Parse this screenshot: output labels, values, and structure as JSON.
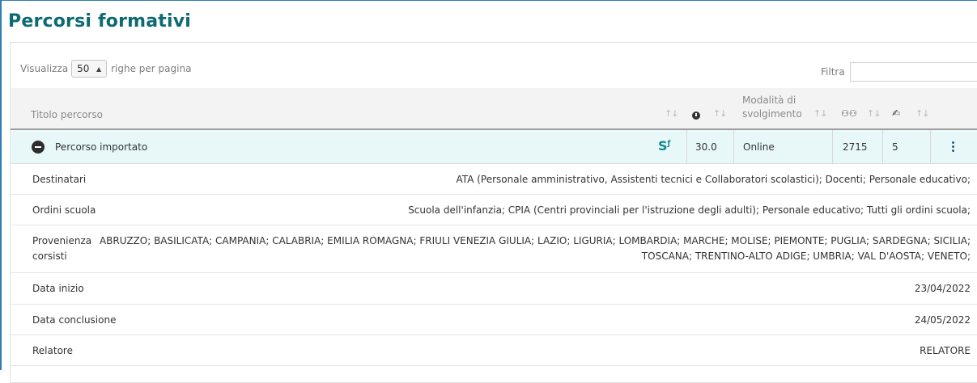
{
  "page": {
    "title": "Percorsi formativi"
  },
  "controls": {
    "length_prefix": "Visualizza",
    "length_value": "50",
    "length_suffix": "righe per pagina",
    "filter_label": "Filtra",
    "filter_value": ""
  },
  "table": {
    "headers": {
      "title": "Titolo percorso",
      "hours_icon": "clock-icon",
      "mode_line1": "Modalità di",
      "mode_line2": "svolgimento",
      "participants_icon": "users-icon",
      "editions_icon": "edit-doc-icon"
    },
    "row": {
      "title": "Percorso importato",
      "hours": "30.0",
      "mode": "Online",
      "participants": "2715",
      "editions": "5",
      "provider_icon": "sf-logo-icon",
      "expand_icon": "minus-circle-icon",
      "menu_icon": "kebab-menu-icon"
    },
    "details": [
      {
        "label": "Destinatari",
        "value": "ATA (Personale amministrativo, Assistenti tecnici e Collaboratori scolastici); Docenti; Personale educativo;"
      },
      {
        "label": "Ordini scuola",
        "value": "Scuola dell'infanzia; CPIA (Centri provinciali per l'istruzione degli adulti); Personale educativo; Tutti gli ordini scuola;"
      },
      {
        "label_line1": "Provenienza",
        "label_line2": "corsisti",
        "value_line1": "ABRUZZO; BASILICATA; CAMPANIA; CALABRIA; EMILIA ROMAGNA; FRIULI VENEZIA GIULIA; LAZIO; LIGURIA; LOMBARDIA; MARCHE; MOLISE; PIEMONTE; PUGLIA; SARDEGNA; SICILIA;",
        "value_line2": "TOSCANA; TRENTINO-ALTO ADIGE; UMBRIA; VAL D'AOSTA; VENETO;"
      },
      {
        "label": "Data inizio",
        "value": "23/04/2022"
      },
      {
        "label": "Data conclusione",
        "value": "24/05/2022"
      },
      {
        "label": "Relatore",
        "value": "RELATORE"
      }
    ]
  },
  "colors": {
    "title": "#0d6a73",
    "row_highlight": "#e8f8f9",
    "accent_border": "#2f7fb3"
  }
}
